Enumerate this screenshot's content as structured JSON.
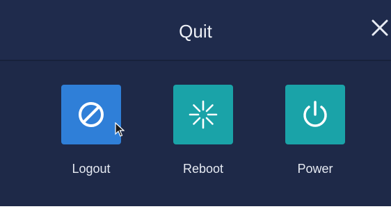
{
  "dialog": {
    "title": "Quit",
    "close_icon": "close-icon"
  },
  "actions": [
    {
      "label": "Logout",
      "icon": "logout-icon",
      "color": "#2f7fd8"
    },
    {
      "label": "Reboot",
      "icon": "reboot-icon",
      "color": "#1aa3a8"
    },
    {
      "label": "Power",
      "icon": "power-icon",
      "color": "#1aa3a8"
    }
  ],
  "colors": {
    "background": "#1f2a49",
    "text": "#e8ecf4"
  }
}
